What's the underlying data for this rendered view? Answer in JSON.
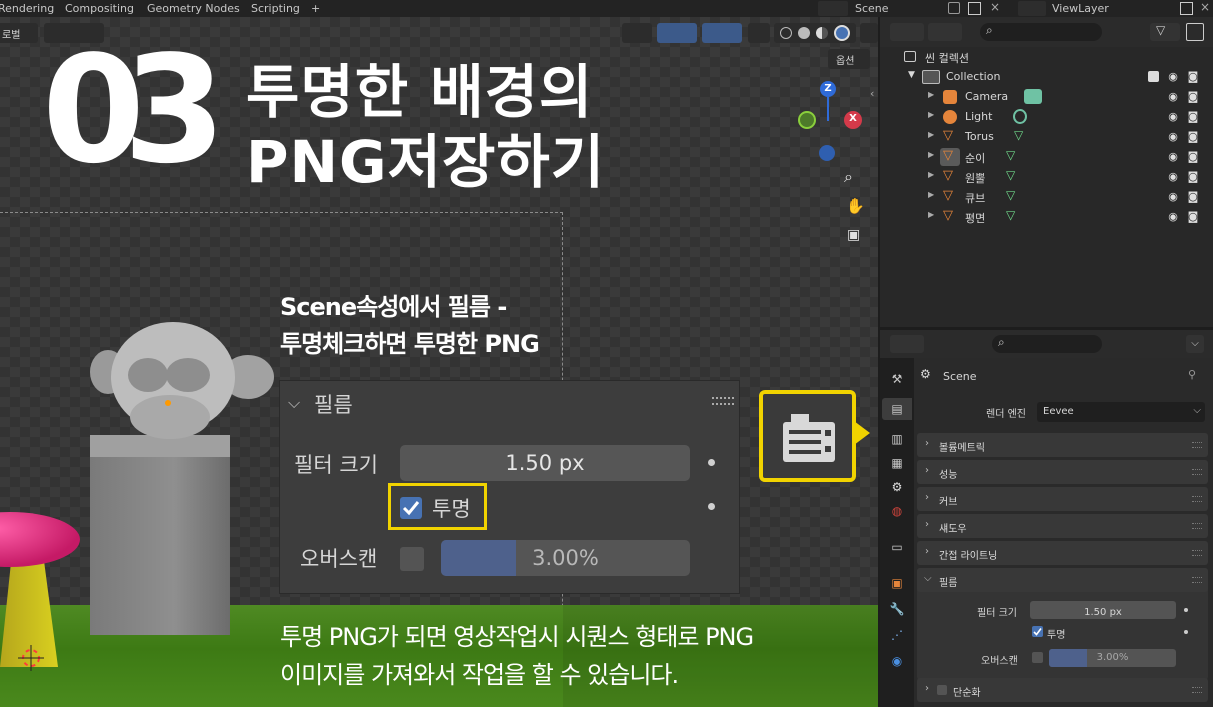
{
  "topbar": {
    "tabs": [
      "Rendering",
      "Compositing",
      "Geometry Nodes",
      "Scripting",
      "+"
    ],
    "scene": "Scene",
    "view_layer": "ViewLayer"
  },
  "viewport": {
    "overlay_label_left": "로벌",
    "options_label": "옵션"
  },
  "title": {
    "number": "03",
    "line1": "투명한 배경의",
    "line2": "PNG저장하기"
  },
  "note": {
    "line1": "Scene속성에서 필름 -",
    "line2": "투명체크하면 투명한 PNG"
  },
  "description": {
    "line1": "투명 PNG가 되면 영상작업시 시퀀스 형태로 PNG",
    "line2": "이미지를 가져와서 작업을 할 수 있습니다."
  },
  "film_zoom": {
    "header": "필름",
    "filter_label": "필터 크기",
    "filter_value": "1.50 px",
    "transparent_label": "투명",
    "transparent_checked": true,
    "overscan_label": "오버스캔",
    "overscan_value": "3.00%",
    "overscan_fraction": 0.3
  },
  "gizmo": {
    "z": "Z",
    "x": "X"
  },
  "outliner": {
    "root": "씬 컬렉션",
    "collection": "Collection",
    "items": [
      {
        "name": "Camera",
        "icon": "camera-icon"
      },
      {
        "name": "Light",
        "icon": "light-icon"
      },
      {
        "name": "Torus",
        "icon": "mesh-icon"
      },
      {
        "name": "순이",
        "icon": "mesh-icon"
      },
      {
        "name": "원뿔",
        "icon": "mesh-icon"
      },
      {
        "name": "큐브",
        "icon": "mesh-icon"
      },
      {
        "name": "평면",
        "icon": "mesh-icon"
      }
    ]
  },
  "properties": {
    "scene_name": "Scene",
    "render_engine_label": "렌더 엔진",
    "render_engine_value": "Eevee",
    "sections": [
      "볼륨메트릭",
      "성능",
      "커브",
      "섀도우",
      "간접 라이트닝"
    ],
    "film": {
      "header": "필름",
      "filter_label": "필터 크기",
      "filter_value": "1.50 px",
      "transparent_label": "투명",
      "overscan_label": "오버스캔",
      "overscan_value": "3.00%"
    },
    "simplify": "단순화"
  },
  "colors": {
    "highlight": "#f1d300",
    "accent": "#4772b3"
  }
}
